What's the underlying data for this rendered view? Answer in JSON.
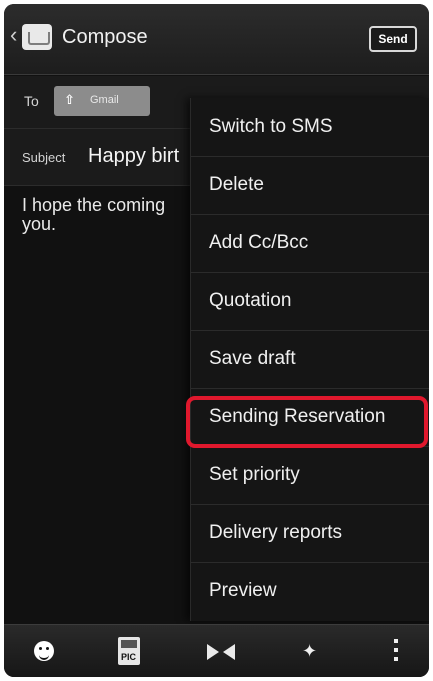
{
  "header": {
    "back_symbol": "‹",
    "title": "Compose",
    "send_label": "Send"
  },
  "compose": {
    "to_label": "To",
    "recipient_chip_text": "Gmail",
    "subject_label": "Subject",
    "subject_value": "Happy birt",
    "body_text": "I hope the coming\nyou."
  },
  "menu": {
    "items": [
      {
        "label": "Switch to SMS"
      },
      {
        "label": "Delete"
      },
      {
        "label": "Add Cc/Bcc"
      },
      {
        "label": "Quotation"
      },
      {
        "label": "Save draft"
      },
      {
        "label": "Sending Reservation",
        "highlighted": true
      },
      {
        "label": "Set priority"
      },
      {
        "label": "Delivery reports"
      },
      {
        "label": "Preview"
      }
    ],
    "highlight_color": "#e0182d"
  },
  "toolbar": {
    "pic_label": "PIC",
    "sparkle_symbol": "✦",
    "icons": [
      "emoji-icon",
      "picture-icon",
      "bowtie-icon",
      "sparkle-icon",
      "more-options-icon"
    ]
  }
}
